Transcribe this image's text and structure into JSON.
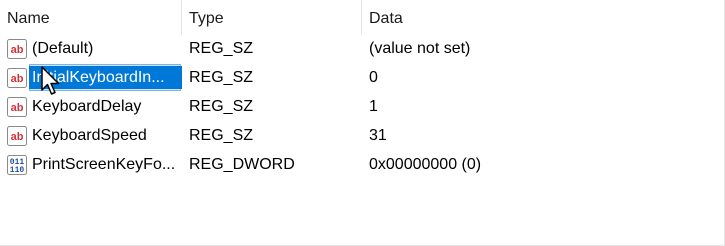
{
  "columns": {
    "name": "Name",
    "type": "Type",
    "data": "Data"
  },
  "rows": [
    {
      "icon": "string-value-icon",
      "name": "(Default)",
      "type": "REG_SZ",
      "data": "(value not set)"
    },
    {
      "icon": "string-value-icon",
      "name": "InitialKeyboardIn...",
      "type": "REG_SZ",
      "data": "0",
      "selected": true
    },
    {
      "icon": "string-value-icon",
      "name": "KeyboardDelay",
      "type": "REG_SZ",
      "data": "1"
    },
    {
      "icon": "string-value-icon",
      "name": "KeyboardSpeed",
      "type": "REG_SZ",
      "data": "31"
    },
    {
      "icon": "binary-value-icon",
      "name": "PrintScreenKeyFo...",
      "type": "REG_DWORD",
      "data": "0x00000000 (0)"
    }
  ],
  "colors": {
    "selection_fill": "#0078d7",
    "selection_outline": "#7eb4ea",
    "string_icon_red": "#d13438"
  }
}
